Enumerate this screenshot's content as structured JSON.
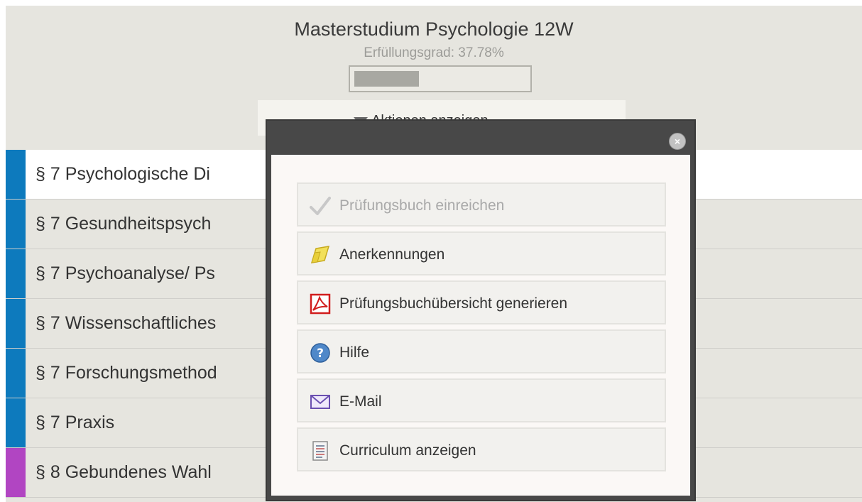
{
  "header": {
    "title": "Masterstudium Psychologie 12W",
    "fulfillment": "Erfüllungsgrad: 37.78%",
    "progress_fraction": 0.3778,
    "actions_button": "Aktionen anzeigen"
  },
  "list": {
    "rows": [
      {
        "label": "§ 7 Psychologische Di",
        "color": "#0d7abd"
      },
      {
        "label": "§ 7 Gesundheitspsych",
        "color": "#0d7abd"
      },
      {
        "label": "§ 7 Psychoanalyse/ Ps",
        "color": "#0d7abd"
      },
      {
        "label": "§ 7 Wissenschaftliches",
        "color": "#0d7abd"
      },
      {
        "label": "§ 7 Forschungsmethod",
        "color": "#0d7abd"
      },
      {
        "label": "§ 7 Praxis",
        "color": "#0d7abd"
      },
      {
        "label": "§ 8 Gebundenes Wahl",
        "color": "#b145c2"
      }
    ]
  },
  "modal": {
    "close_icon": "close-icon",
    "items": [
      {
        "label": "Prüfungsbuch einreichen",
        "icon": "checkmark-icon",
        "disabled": true
      },
      {
        "label": "Anerkennungen",
        "icon": "folder-icon",
        "disabled": false
      },
      {
        "label": "Prüfungsbuchübersicht generieren",
        "icon": "pdf-icon",
        "disabled": false
      },
      {
        "label": "Hilfe",
        "icon": "help-icon",
        "disabled": false
      },
      {
        "label": "E-Mail",
        "icon": "envelope-icon",
        "disabled": false
      },
      {
        "label": "Curriculum anzeigen",
        "icon": "document-icon",
        "disabled": false
      }
    ]
  }
}
